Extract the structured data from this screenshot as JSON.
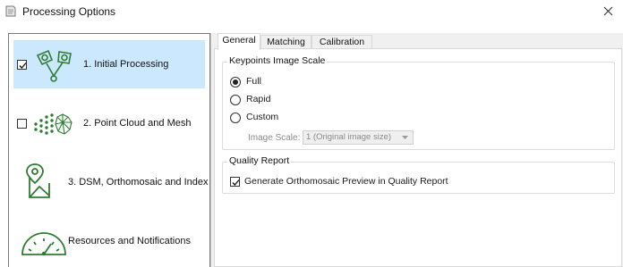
{
  "window": {
    "title": "Processing Options"
  },
  "steps": [
    {
      "label": "1. Initial Processing",
      "checked": true,
      "selected": true,
      "icon": "keypoints-icon"
    },
    {
      "label": "2. Point Cloud and Mesh",
      "checked": false,
      "selected": false,
      "icon": "point-cloud-icon"
    },
    {
      "label": "3. DSM, Orthomosaic and Index",
      "checked": null,
      "selected": false,
      "icon": "map-icon"
    },
    {
      "label": "Resources and Notifications",
      "checked": null,
      "selected": false,
      "icon": "gauge-icon"
    }
  ],
  "tabs": [
    {
      "label": "General",
      "active": true
    },
    {
      "label": "Matching",
      "active": false
    },
    {
      "label": "Calibration",
      "active": false
    }
  ],
  "keypoints": {
    "group_title": "Keypoints Image Scale",
    "options": [
      {
        "label": "Full",
        "selected": true
      },
      {
        "label": "Rapid",
        "selected": false
      },
      {
        "label": "Custom",
        "selected": false
      }
    ],
    "image_scale_label": "Image Scale:",
    "image_scale_value": "1 (Original image size)"
  },
  "quality_report": {
    "group_title": "Quality Report",
    "preview_label": "Generate Orthomosaic Preview in Quality Report",
    "preview_checked": true
  },
  "colors": {
    "selection": "#cce8ff",
    "icon_green": "#2e7d32",
    "panel_bg": "#f0f0f0"
  }
}
